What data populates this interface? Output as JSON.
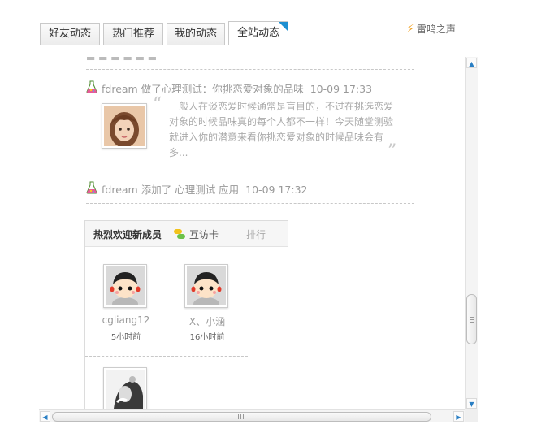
{
  "tabs": [
    {
      "label": "好友动态",
      "active": false
    },
    {
      "label": "热门推荐",
      "active": false
    },
    {
      "label": "我的动态",
      "active": false
    },
    {
      "label": "全站动态",
      "active": true
    }
  ],
  "voice_link": {
    "label": "雷鸣之声",
    "icon": "lightning-icon"
  },
  "feed": [
    {
      "icon": "flask-icon",
      "user": "fdream",
      "action": "做了心理测试：你挑恋爱对象的品味",
      "time": "10-09 17:33",
      "excerpt": "一般人在谈恋爱时候通常是盲目的，不过在挑选恋爱对象的时候品味真的每个人都不一样！今天随堂测验就进入你的潜意来看你挑恋爱对象的时候品味会有多...",
      "avatar": "girl-photo"
    },
    {
      "icon": "flask-icon",
      "user": "fdream",
      "action": "添加了 心理测试 应用",
      "time": "10-09 17:32"
    }
  ],
  "welcome_box": {
    "title": "热烈欢迎新成员",
    "visit_card": "互访卡",
    "rank": "排行",
    "members": [
      {
        "name": "cgliang12",
        "time": "5小时前",
        "avatar": "cartoon-boy"
      },
      {
        "name": "X、小涵",
        "time": "16小时前",
        "avatar": "cartoon-boy"
      },
      {
        "avatar": "bw-photo"
      }
    ]
  },
  "colors": {
    "tab_corner": "#1d8fd1",
    "scroll_arrow": "#2a7fc4"
  }
}
